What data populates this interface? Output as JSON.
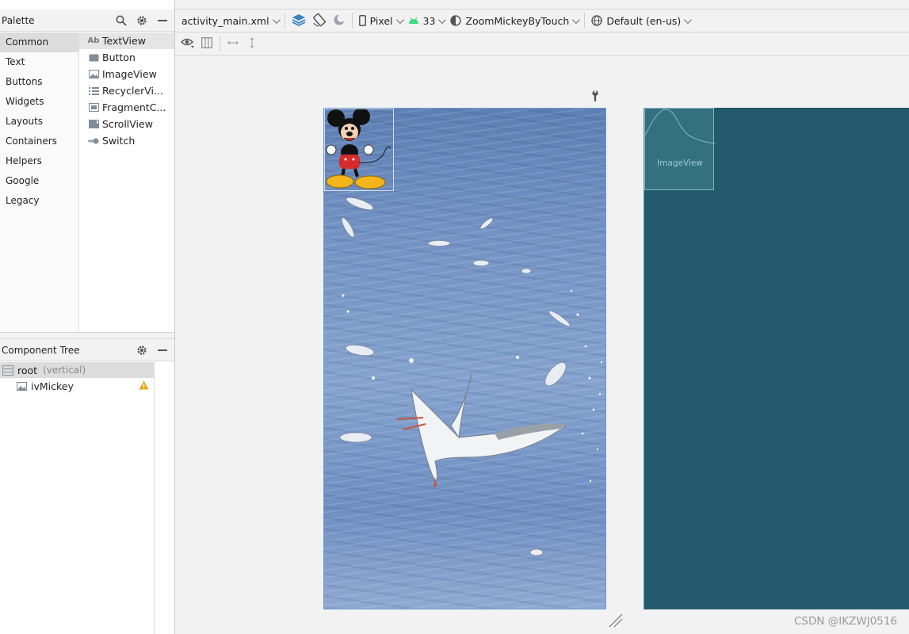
{
  "palette": {
    "title": "Palette",
    "categories": [
      {
        "label": "Common",
        "selected": true
      },
      {
        "label": "Text"
      },
      {
        "label": "Buttons"
      },
      {
        "label": "Widgets"
      },
      {
        "label": "Layouts"
      },
      {
        "label": "Containers"
      },
      {
        "label": "Helpers"
      },
      {
        "label": "Google"
      },
      {
        "label": "Legacy"
      }
    ],
    "widgets": [
      {
        "label": "TextView",
        "icon": "textview-icon",
        "icon_text": "Ab",
        "selected": true
      },
      {
        "label": "Button",
        "icon": "button-icon"
      },
      {
        "label": "ImageView",
        "icon": "imageview-icon"
      },
      {
        "label": "RecyclerVi...",
        "icon": "recyclerview-icon"
      },
      {
        "label": "FragmentC...",
        "icon": "fragmentcontainer-icon"
      },
      {
        "label": "ScrollView",
        "icon": "scrollview-icon"
      },
      {
        "label": "Switch",
        "icon": "switch-icon"
      }
    ]
  },
  "component_tree": {
    "title": "Component Tree",
    "root": {
      "label": "root",
      "detail": "(vertical)"
    },
    "children": [
      {
        "label": "ivMickey",
        "warning": true
      }
    ]
  },
  "toolbar": {
    "file": "activity_main.xml",
    "device": "Pixel",
    "api": "33",
    "theme": "ZoomMickeyByTouch",
    "locale": "Default (en-us)"
  },
  "canvas": {
    "blueprint_label": "ImageView",
    "watermark": "CSDN @IKZWJ0516"
  },
  "colors": {
    "blueprint_bg": "#245a6e",
    "selection_border": "#6b9bd2",
    "warning": "#e8a317",
    "android_green": "#3ddc84"
  }
}
